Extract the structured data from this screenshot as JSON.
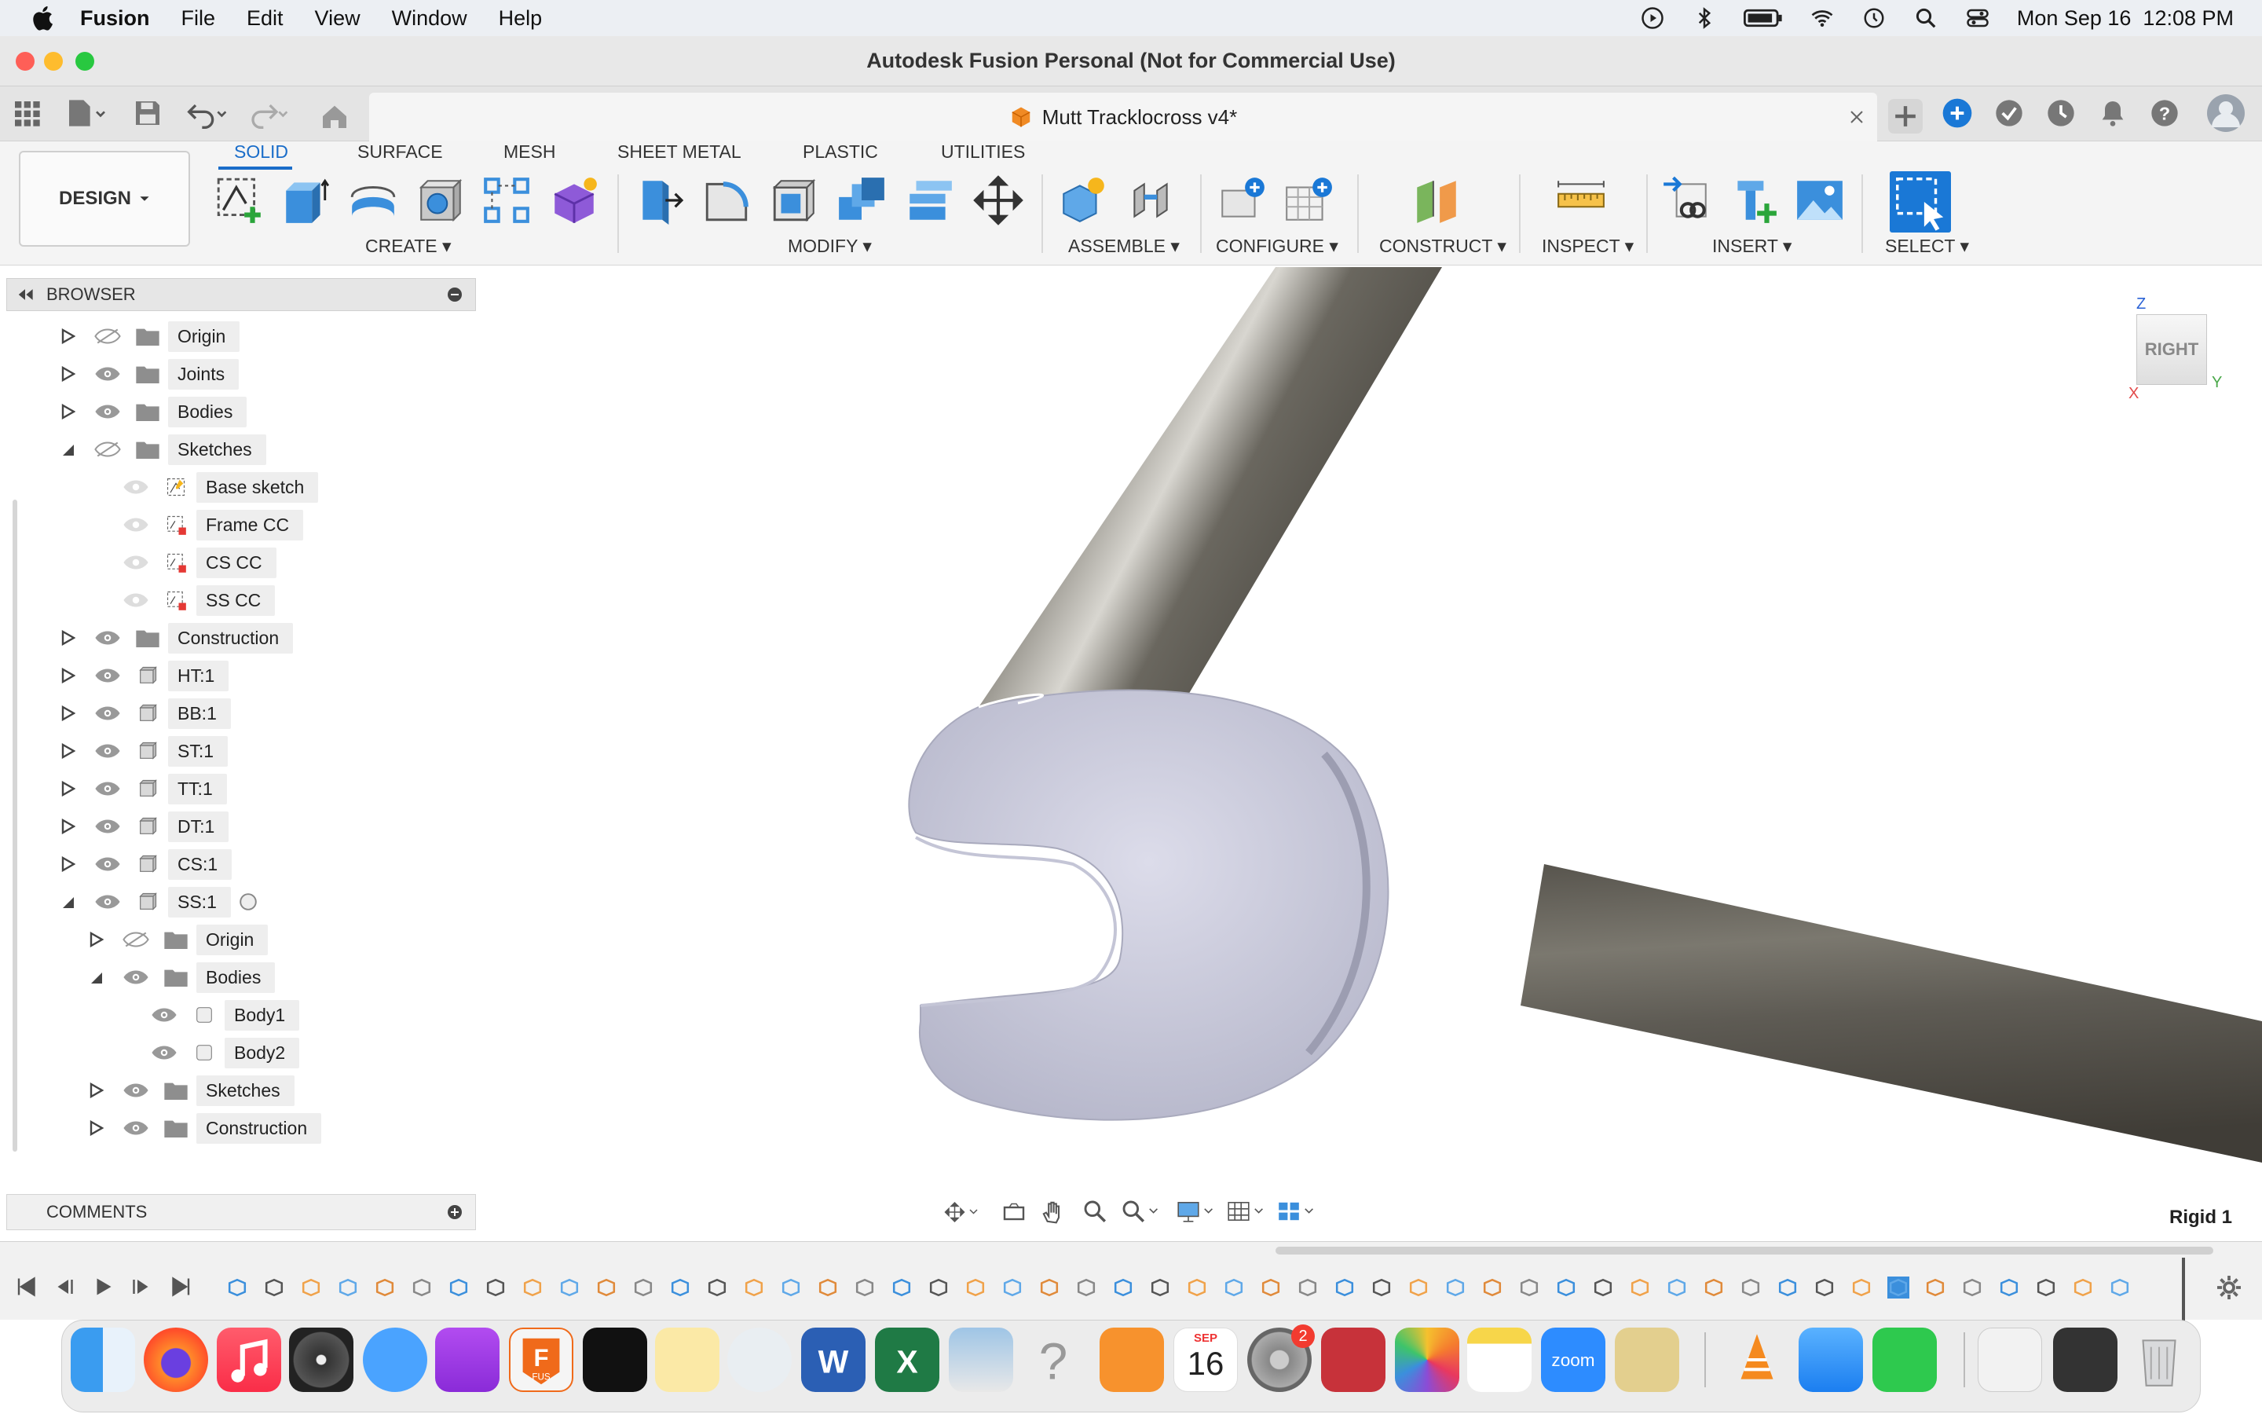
{
  "menubar": {
    "app_name": "Fusion",
    "items": [
      "File",
      "Edit",
      "View",
      "Window",
      "Help"
    ],
    "clock": "Mon Sep 16  12:08 PM"
  },
  "window": {
    "title": "Autodesk Fusion Personal (Not for Commercial Use)",
    "document_tab": "Mutt Tracklocross v4*"
  },
  "toolbar": {
    "workspace": "DESIGN",
    "tabs": [
      "SOLID",
      "SURFACE",
      "MESH",
      "SHEET METAL",
      "PLASTIC",
      "UTILITIES"
    ],
    "groups": [
      "CREATE",
      "MODIFY",
      "ASSEMBLE",
      "CONFIGURE",
      "CONSTRUCT",
      "INSPECT",
      "INSERT",
      "SELECT"
    ]
  },
  "browser": {
    "title": "BROWSER",
    "items": [
      {
        "label": "Origin"
      },
      {
        "label": "Joints"
      },
      {
        "label": "Bodies"
      },
      {
        "label": "Sketches"
      },
      {
        "label": "Base sketch"
      },
      {
        "label": "Frame CC"
      },
      {
        "label": "CS CC"
      },
      {
        "label": "SS CC"
      },
      {
        "label": "Construction"
      },
      {
        "label": "HT:1"
      },
      {
        "label": "BB:1"
      },
      {
        "label": "ST:1"
      },
      {
        "label": "TT:1"
      },
      {
        "label": "DT:1"
      },
      {
        "label": "CS:1"
      },
      {
        "label": "SS:1"
      },
      {
        "label": "Origin"
      },
      {
        "label": "Bodies"
      },
      {
        "label": "Body1"
      },
      {
        "label": "Body2"
      },
      {
        "label": "Sketches"
      },
      {
        "label": "Construction"
      }
    ]
  },
  "comments": {
    "title": "COMMENTS"
  },
  "viewcube": {
    "face": "RIGHT",
    "axis_z": "Z",
    "axis_x": "X",
    "axis_y": "Y"
  },
  "status": {
    "joint_type": "Rigid 1"
  },
  "dock": {
    "calendar_month": "SEP",
    "calendar_day": "16",
    "settings_badge": "2",
    "fusion_label": "FUS"
  },
  "colors": {
    "accent": "#1a6dc9",
    "tube": "#5f5c55",
    "part": "#c9cad9"
  }
}
